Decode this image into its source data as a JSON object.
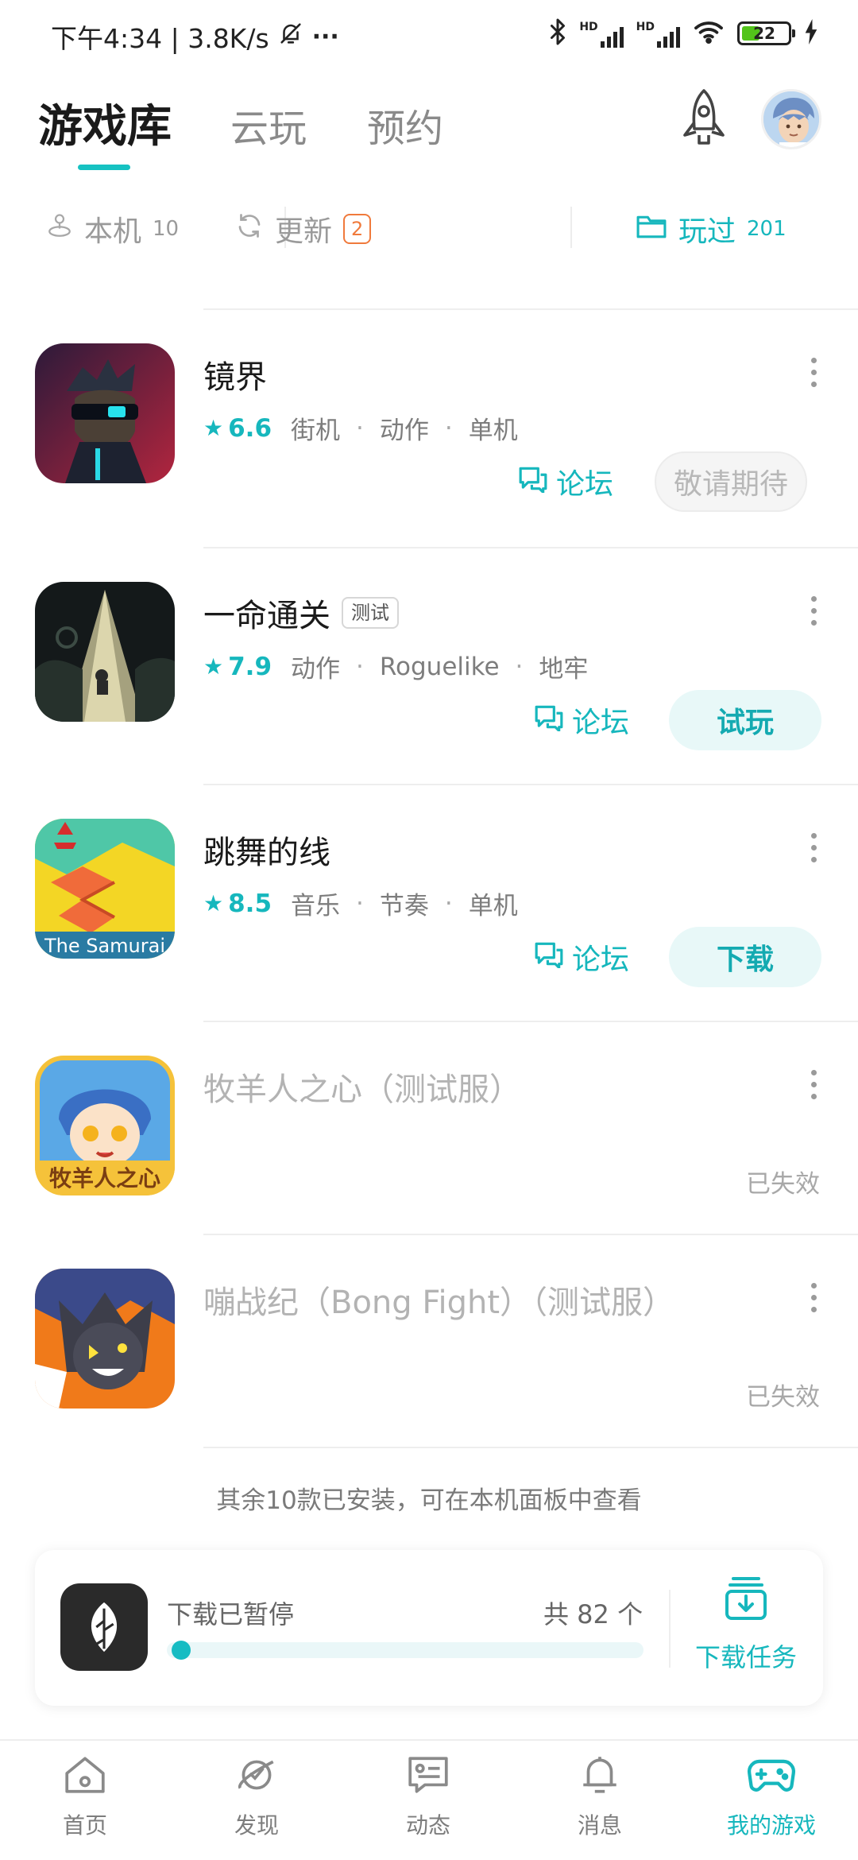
{
  "status_bar": {
    "time_speed": "下午4:34 | 3.8K/s",
    "more": "···",
    "signal1": "HD",
    "signal2": "HD",
    "battery": "22"
  },
  "header": {
    "tabs": [
      {
        "label": "游戏库",
        "active": true
      },
      {
        "label": "云玩",
        "active": false
      },
      {
        "label": "预约",
        "active": false
      }
    ],
    "icons": [
      "rocket-icon",
      "user-avatar"
    ]
  },
  "segments": [
    {
      "label": "本机",
      "count": "10",
      "icon": "joystick-icon"
    },
    {
      "label": "更新",
      "badge": "2",
      "icon": "refresh-icon"
    },
    {
      "label": "玩过",
      "count": "201",
      "icon": "folder-icon",
      "active": true
    }
  ],
  "games": [
    {
      "title": "镜界",
      "rating": "6.6",
      "tags": [
        "街机",
        "动作",
        "单机"
      ],
      "forum": "论坛",
      "action": "敬请期待",
      "action_state": "disabled"
    },
    {
      "title": "一命通关",
      "tag_badge": "测试",
      "rating": "7.9",
      "tags": [
        "动作",
        "Roguelike",
        "地牢"
      ],
      "forum": "论坛",
      "action": "试玩",
      "action_state": "primary"
    },
    {
      "title": "跳舞的线",
      "rating": "8.5",
      "tags": [
        "音乐",
        "节奏",
        "单机"
      ],
      "forum": "论坛",
      "action": "下载",
      "action_state": "primary",
      "icon_caption": "The Samurai"
    },
    {
      "title": "牧羊人之心（测试服）",
      "status": "已失效",
      "expired": true,
      "icon_caption": "牧羊人之心"
    },
    {
      "title": "嘣战纪（Bong Fight）（测试服）",
      "status": "已失效",
      "expired": true
    }
  ],
  "footnote": "其余10款已安装，可在本机面板中查看",
  "download": {
    "status": "下载已暂停",
    "count": "共 82 个",
    "progress_fraction": 0.01,
    "task_label": "下载任务"
  },
  "bottom_nav": [
    {
      "label": "首页",
      "icon": "home-icon"
    },
    {
      "label": "发现",
      "icon": "planet-icon"
    },
    {
      "label": "动态",
      "icon": "chat-icon"
    },
    {
      "label": "消息",
      "icon": "bell-icon"
    },
    {
      "label": "我的游戏",
      "icon": "gamepad-icon",
      "active": true
    }
  ],
  "colors": {
    "accent": "#16b7bd",
    "badge_orange": "#f07a3c",
    "star": "#16b7bd"
  }
}
